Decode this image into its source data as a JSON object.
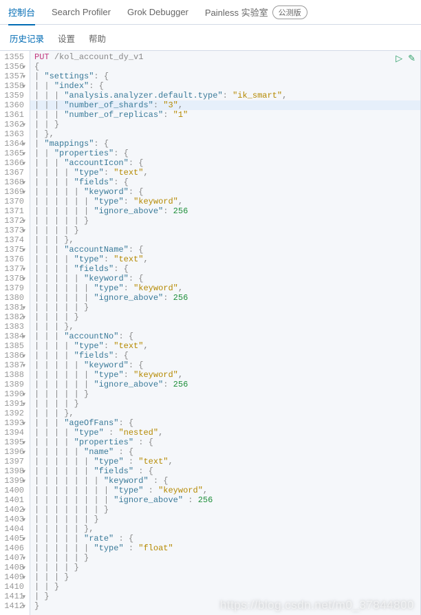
{
  "topTabs": {
    "console": "控制台",
    "searchProfiler": "Search Profiler",
    "grokDebugger": "Grok Debugger",
    "painlessLab": "Painless 实验室",
    "betaBadge": "公测版"
  },
  "subTabs": {
    "history": "历史记录",
    "settings": "设置",
    "help": "帮助"
  },
  "editor": {
    "startLine": 1355,
    "highlightLine": 1360,
    "method": "PUT",
    "path": "/kol_account_dy_v1",
    "lines": [
      {
        "n": 1355,
        "t": "req"
      },
      {
        "n": 1356,
        "t": "open",
        "txt": "{",
        "fold": true
      },
      {
        "n": 1357,
        "t": "kv",
        "indent": 1,
        "k": "settings",
        "v": "{",
        "fold": true
      },
      {
        "n": 1358,
        "t": "kv",
        "indent": 2,
        "k": "index",
        "v": "{",
        "fold": true
      },
      {
        "n": 1359,
        "t": "kvstr",
        "indent": 3,
        "k": "analysis.analyzer.default.type",
        "v": "ik_smart",
        "comma": true
      },
      {
        "n": 1360,
        "t": "kvstr",
        "indent": 3,
        "k": "number_of_shards",
        "v": "3",
        "comma": true,
        "hl": true
      },
      {
        "n": 1361,
        "t": "kvstr",
        "indent": 3,
        "k": "number_of_replicas",
        "v": "1"
      },
      {
        "n": 1362,
        "t": "close",
        "indent": 2,
        "txt": "}",
        "fold": true
      },
      {
        "n": 1363,
        "t": "close",
        "indent": 1,
        "txt": "},"
      },
      {
        "n": 1364,
        "t": "kv",
        "indent": 1,
        "k": "mappings",
        "v": "{",
        "fold": true
      },
      {
        "n": 1365,
        "t": "kv",
        "indent": 2,
        "k": "properties",
        "v": "{",
        "fold": true
      },
      {
        "n": 1366,
        "t": "kv",
        "indent": 3,
        "k": "accountIcon",
        "v": "{",
        "fold": true
      },
      {
        "n": 1367,
        "t": "kvstr",
        "indent": 4,
        "k": "type",
        "v": "text",
        "comma": true
      },
      {
        "n": 1368,
        "t": "kv",
        "indent": 4,
        "k": "fields",
        "v": "{",
        "fold": true
      },
      {
        "n": 1369,
        "t": "kv",
        "indent": 5,
        "k": "keyword",
        "v": "{",
        "fold": true
      },
      {
        "n": 1370,
        "t": "kvstr",
        "indent": 6,
        "k": "type",
        "v": "keyword",
        "comma": true
      },
      {
        "n": 1371,
        "t": "kvnum",
        "indent": 6,
        "k": "ignore_above",
        "v": 256
      },
      {
        "n": 1372,
        "t": "close",
        "indent": 5,
        "txt": "}",
        "fold": true
      },
      {
        "n": 1373,
        "t": "close",
        "indent": 4,
        "txt": "}",
        "fold": true
      },
      {
        "n": 1374,
        "t": "close",
        "indent": 3,
        "txt": "},"
      },
      {
        "n": 1375,
        "t": "kv",
        "indent": 3,
        "k": "accountName",
        "v": "{",
        "fold": true
      },
      {
        "n": 1376,
        "t": "kvstr",
        "indent": 4,
        "k": "type",
        "v": "text",
        "comma": true
      },
      {
        "n": 1377,
        "t": "kv",
        "indent": 4,
        "k": "fields",
        "v": "{",
        "fold": true
      },
      {
        "n": 1378,
        "t": "kv",
        "indent": 5,
        "k": "keyword",
        "v": "{",
        "fold": true
      },
      {
        "n": 1379,
        "t": "kvstr",
        "indent": 6,
        "k": "type",
        "v": "keyword",
        "comma": true
      },
      {
        "n": 1380,
        "t": "kvnum",
        "indent": 6,
        "k": "ignore_above",
        "v": 256
      },
      {
        "n": 1381,
        "t": "close",
        "indent": 5,
        "txt": "}",
        "fold": true
      },
      {
        "n": 1382,
        "t": "close",
        "indent": 4,
        "txt": "}",
        "fold": true
      },
      {
        "n": 1383,
        "t": "close",
        "indent": 3,
        "txt": "},"
      },
      {
        "n": 1384,
        "t": "kv",
        "indent": 3,
        "k": "accountNo",
        "v": "{",
        "fold": true
      },
      {
        "n": 1385,
        "t": "kvstr",
        "indent": 4,
        "k": "type",
        "v": "text",
        "comma": true
      },
      {
        "n": 1386,
        "t": "kv",
        "indent": 4,
        "k": "fields",
        "v": "{",
        "fold": true
      },
      {
        "n": 1387,
        "t": "kv",
        "indent": 5,
        "k": "keyword",
        "v": "{",
        "fold": true
      },
      {
        "n": 1388,
        "t": "kvstr",
        "indent": 6,
        "k": "type",
        "v": "keyword",
        "comma": true
      },
      {
        "n": 1389,
        "t": "kvnum",
        "indent": 6,
        "k": "ignore_above",
        "v": 256
      },
      {
        "n": 1390,
        "t": "close",
        "indent": 5,
        "txt": "}",
        "fold": true
      },
      {
        "n": 1391,
        "t": "close",
        "indent": 4,
        "txt": "}",
        "fold": true
      },
      {
        "n": 1392,
        "t": "close",
        "indent": 3,
        "txt": "},"
      },
      {
        "n": 1393,
        "t": "kv",
        "indent": 3,
        "k": "ageOfFans",
        "v": "{",
        "fold": true
      },
      {
        "n": 1394,
        "t": "kvstr",
        "indent": 4,
        "k": "type",
        "v": "nested",
        "comma": true,
        "sp": true
      },
      {
        "n": 1395,
        "t": "kv",
        "indent": 4,
        "k": "properties",
        "v": "{",
        "fold": true,
        "sp": true
      },
      {
        "n": 1396,
        "t": "kv",
        "indent": 5,
        "k": "name",
        "v": "{",
        "fold": true,
        "sp": true
      },
      {
        "n": 1397,
        "t": "kvstr",
        "indent": 6,
        "k": "type",
        "v": "text",
        "comma": true,
        "sp": true
      },
      {
        "n": 1398,
        "t": "kv",
        "indent": 6,
        "k": "fields",
        "v": "{",
        "fold": true,
        "sp": true
      },
      {
        "n": 1399,
        "t": "kv",
        "indent": 7,
        "k": "keyword",
        "v": "{",
        "fold": true,
        "sp": true
      },
      {
        "n": 1400,
        "t": "kvstr",
        "indent": 8,
        "k": "type",
        "v": "keyword",
        "comma": true,
        "sp": true
      },
      {
        "n": 1401,
        "t": "kvnum",
        "indent": 8,
        "k": "ignore_above",
        "v": 256,
        "sp": true
      },
      {
        "n": 1402,
        "t": "close",
        "indent": 7,
        "txt": "}",
        "fold": true
      },
      {
        "n": 1403,
        "t": "close",
        "indent": 6,
        "txt": "}",
        "fold": true
      },
      {
        "n": 1404,
        "t": "close",
        "indent": 5,
        "txt": "},"
      },
      {
        "n": 1405,
        "t": "kv",
        "indent": 5,
        "k": "rate",
        "v": "{",
        "fold": true,
        "sp": true
      },
      {
        "n": 1406,
        "t": "kvstr",
        "indent": 6,
        "k": "type",
        "v": "float",
        "sp": true
      },
      {
        "n": 1407,
        "t": "close",
        "indent": 5,
        "txt": "}",
        "fold": true
      },
      {
        "n": 1408,
        "t": "close",
        "indent": 4,
        "txt": "}",
        "fold": true
      },
      {
        "n": 1409,
        "t": "close",
        "indent": 3,
        "txt": "}",
        "fold": true
      },
      {
        "n": 1410,
        "t": "close",
        "indent": 2,
        "txt": "}"
      },
      {
        "n": 1411,
        "t": "close",
        "indent": 1,
        "txt": "}",
        "fold": true
      },
      {
        "n": 1412,
        "t": "close",
        "indent": 0,
        "txt": "}",
        "fold": true
      }
    ]
  },
  "watermark": "https://blog.csdn.net/m0_37844800"
}
